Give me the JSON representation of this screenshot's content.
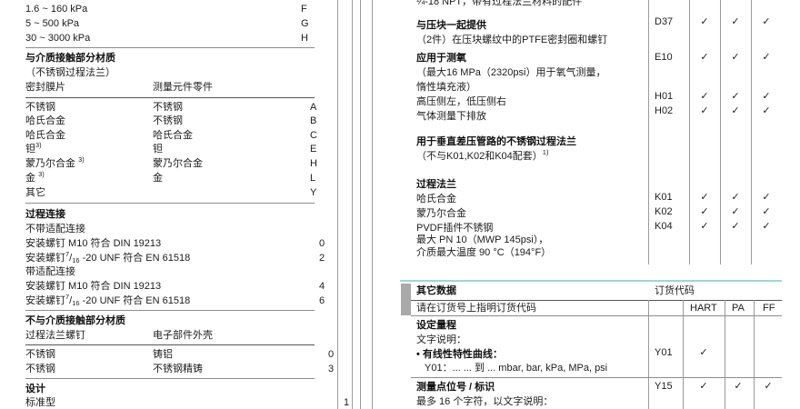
{
  "left": {
    "ranges": [
      {
        "label": "1.6 ~ 160 kPa",
        "code": "F"
      },
      {
        "label": "5 ~ 500 kPa",
        "code": "G"
      },
      {
        "label": "30 ~ 3000 kPa",
        "code": "H"
      }
    ],
    "wetted": {
      "title": "与介质接触部分材质",
      "subtitle": "（不锈钢过程法兰）",
      "headers": [
        "密封膜片",
        "测量元件零件"
      ],
      "rows": [
        {
          "diaphragm": "不锈钢",
          "parts": "不锈钢",
          "code": "A"
        },
        {
          "diaphragm": "哈氏合金",
          "parts": "不锈钢",
          "code": "B"
        },
        {
          "diaphragm": "哈氏合金",
          "parts": "哈氏合金",
          "code": "C"
        },
        {
          "diaphragm": "钽",
          "note": "3)",
          "parts": "钽",
          "code": "E"
        },
        {
          "diaphragm": "蒙乃尔合金 ",
          "note": "3)",
          "parts": "蒙乃尔合金",
          "code": "H"
        },
        {
          "diaphragm": "金 ",
          "note": "3)",
          "parts": "金",
          "code": "L"
        },
        {
          "diaphragm": "其它",
          "code": "Y"
        }
      ]
    },
    "process": {
      "title": "过程连接",
      "without_adapter": "不带适配连接",
      "with_adapter": "带适配连接",
      "rows": [
        {
          "text": "安装螺钉 M10 符合 DIN 19213",
          "code": "0"
        },
        {
          "prefix": "安装螺钉",
          "num": "7",
          "slash": "/",
          "den": "16",
          "suffix": " -20 UNF 符合 EN 61518",
          "code": "2"
        },
        {
          "text": "安装螺钉 M10 符合 DIN 19213",
          "code": "4"
        },
        {
          "prefix": "安装螺钉",
          "num": "7",
          "slash": "/",
          "den": "16",
          "suffix": " -20 UNF 符合 EN 61518",
          "code": "6"
        }
      ]
    },
    "nonwetted": {
      "title": "不与介质接触部分材质",
      "headers": [
        "过程法兰螺钉",
        "电子部件外壳"
      ],
      "rows": [
        {
          "screws": "不锈钢",
          "housing": "铸铝",
          "code": "0"
        },
        {
          "screws": "不锈钢",
          "housing": "不锈钢精铸",
          "code": "3"
        }
      ]
    },
    "design": {
      "title": "设计",
      "rows": [
        {
          "label": "标准型",
          "code": "1"
        }
      ]
    }
  },
  "right": {
    "npt_note": "¼-18 NPT，带有过程法兰材料的配件",
    "options": {
      "d37": {
        "title": "与压块一起提供",
        "desc": "（2件）在压块螺纹中的PTFE密封圈和螺钉",
        "code": "D37",
        "checks": [
          "✓",
          "✓",
          "✓"
        ]
      },
      "e10": {
        "title": "应用于测氧",
        "desc": [
          "（最大16 MPa（2320psi）用于氧气测量，",
          " 惰性填充液）"
        ],
        "code": "E10",
        "checks": [
          "✓",
          "✓",
          "✓"
        ]
      },
      "h01": {
        "label": "高压侧左，低压侧右",
        "code": "H01",
        "checks": [
          "✓",
          "✓",
          "✓"
        ]
      },
      "h02": {
        "label": "气体测量下排放",
        "code": "H02",
        "checks": [
          "✓",
          "✓",
          "✓"
        ]
      },
      "vertical": {
        "title": "用于垂直差压管路的不锈钢过程法兰",
        "desc": "（不与K01,K02和K04配套）",
        "note": "1)"
      },
      "flanges": {
        "title": "过程法兰",
        "rows": [
          {
            "label": "哈氏合金",
            "code": "K01",
            "checks": [
              "✓",
              "✓",
              "✓"
            ]
          },
          {
            "label": "蒙乃尔合金",
            "code": "K02",
            "checks": [
              "✓",
              "✓",
              "✓"
            ]
          },
          {
            "label": "PVDF插件不锈钢",
            "code": "K04",
            "checks": [
              "✓",
              "✓",
              "✓"
            ]
          }
        ],
        "limits": [
          "最大 PN 10（MWP 145psi），",
          "介质最大温度 90 °C（194°F）"
        ]
      }
    },
    "other": {
      "title": "其它数据",
      "code_header": "订货代码",
      "instruction": "请在订货号上指明订货代码",
      "protocols": [
        "HART",
        "PA",
        "FF"
      ],
      "range": {
        "title": "设定量程",
        "text_label": "文字说明：",
        "linear": "• 有线性特性曲线：",
        "code": "Y01",
        "checks": [
          "✓",
          "",
          ""
        ],
        "example": "Y01：... ... 到 ... mbar, bar, kPa, MPa, psi"
      },
      "tag": {
        "title": "测量点位号 / 标识",
        "code": "Y15",
        "checks": [
          "✓",
          "✓",
          "✓"
        ],
        "desc": "最多 16 个字符，以文字说明："
      }
    },
    "colors": {
      "accent_rule": "#9fd6d8",
      "marker": "#a9a9a9"
    }
  }
}
